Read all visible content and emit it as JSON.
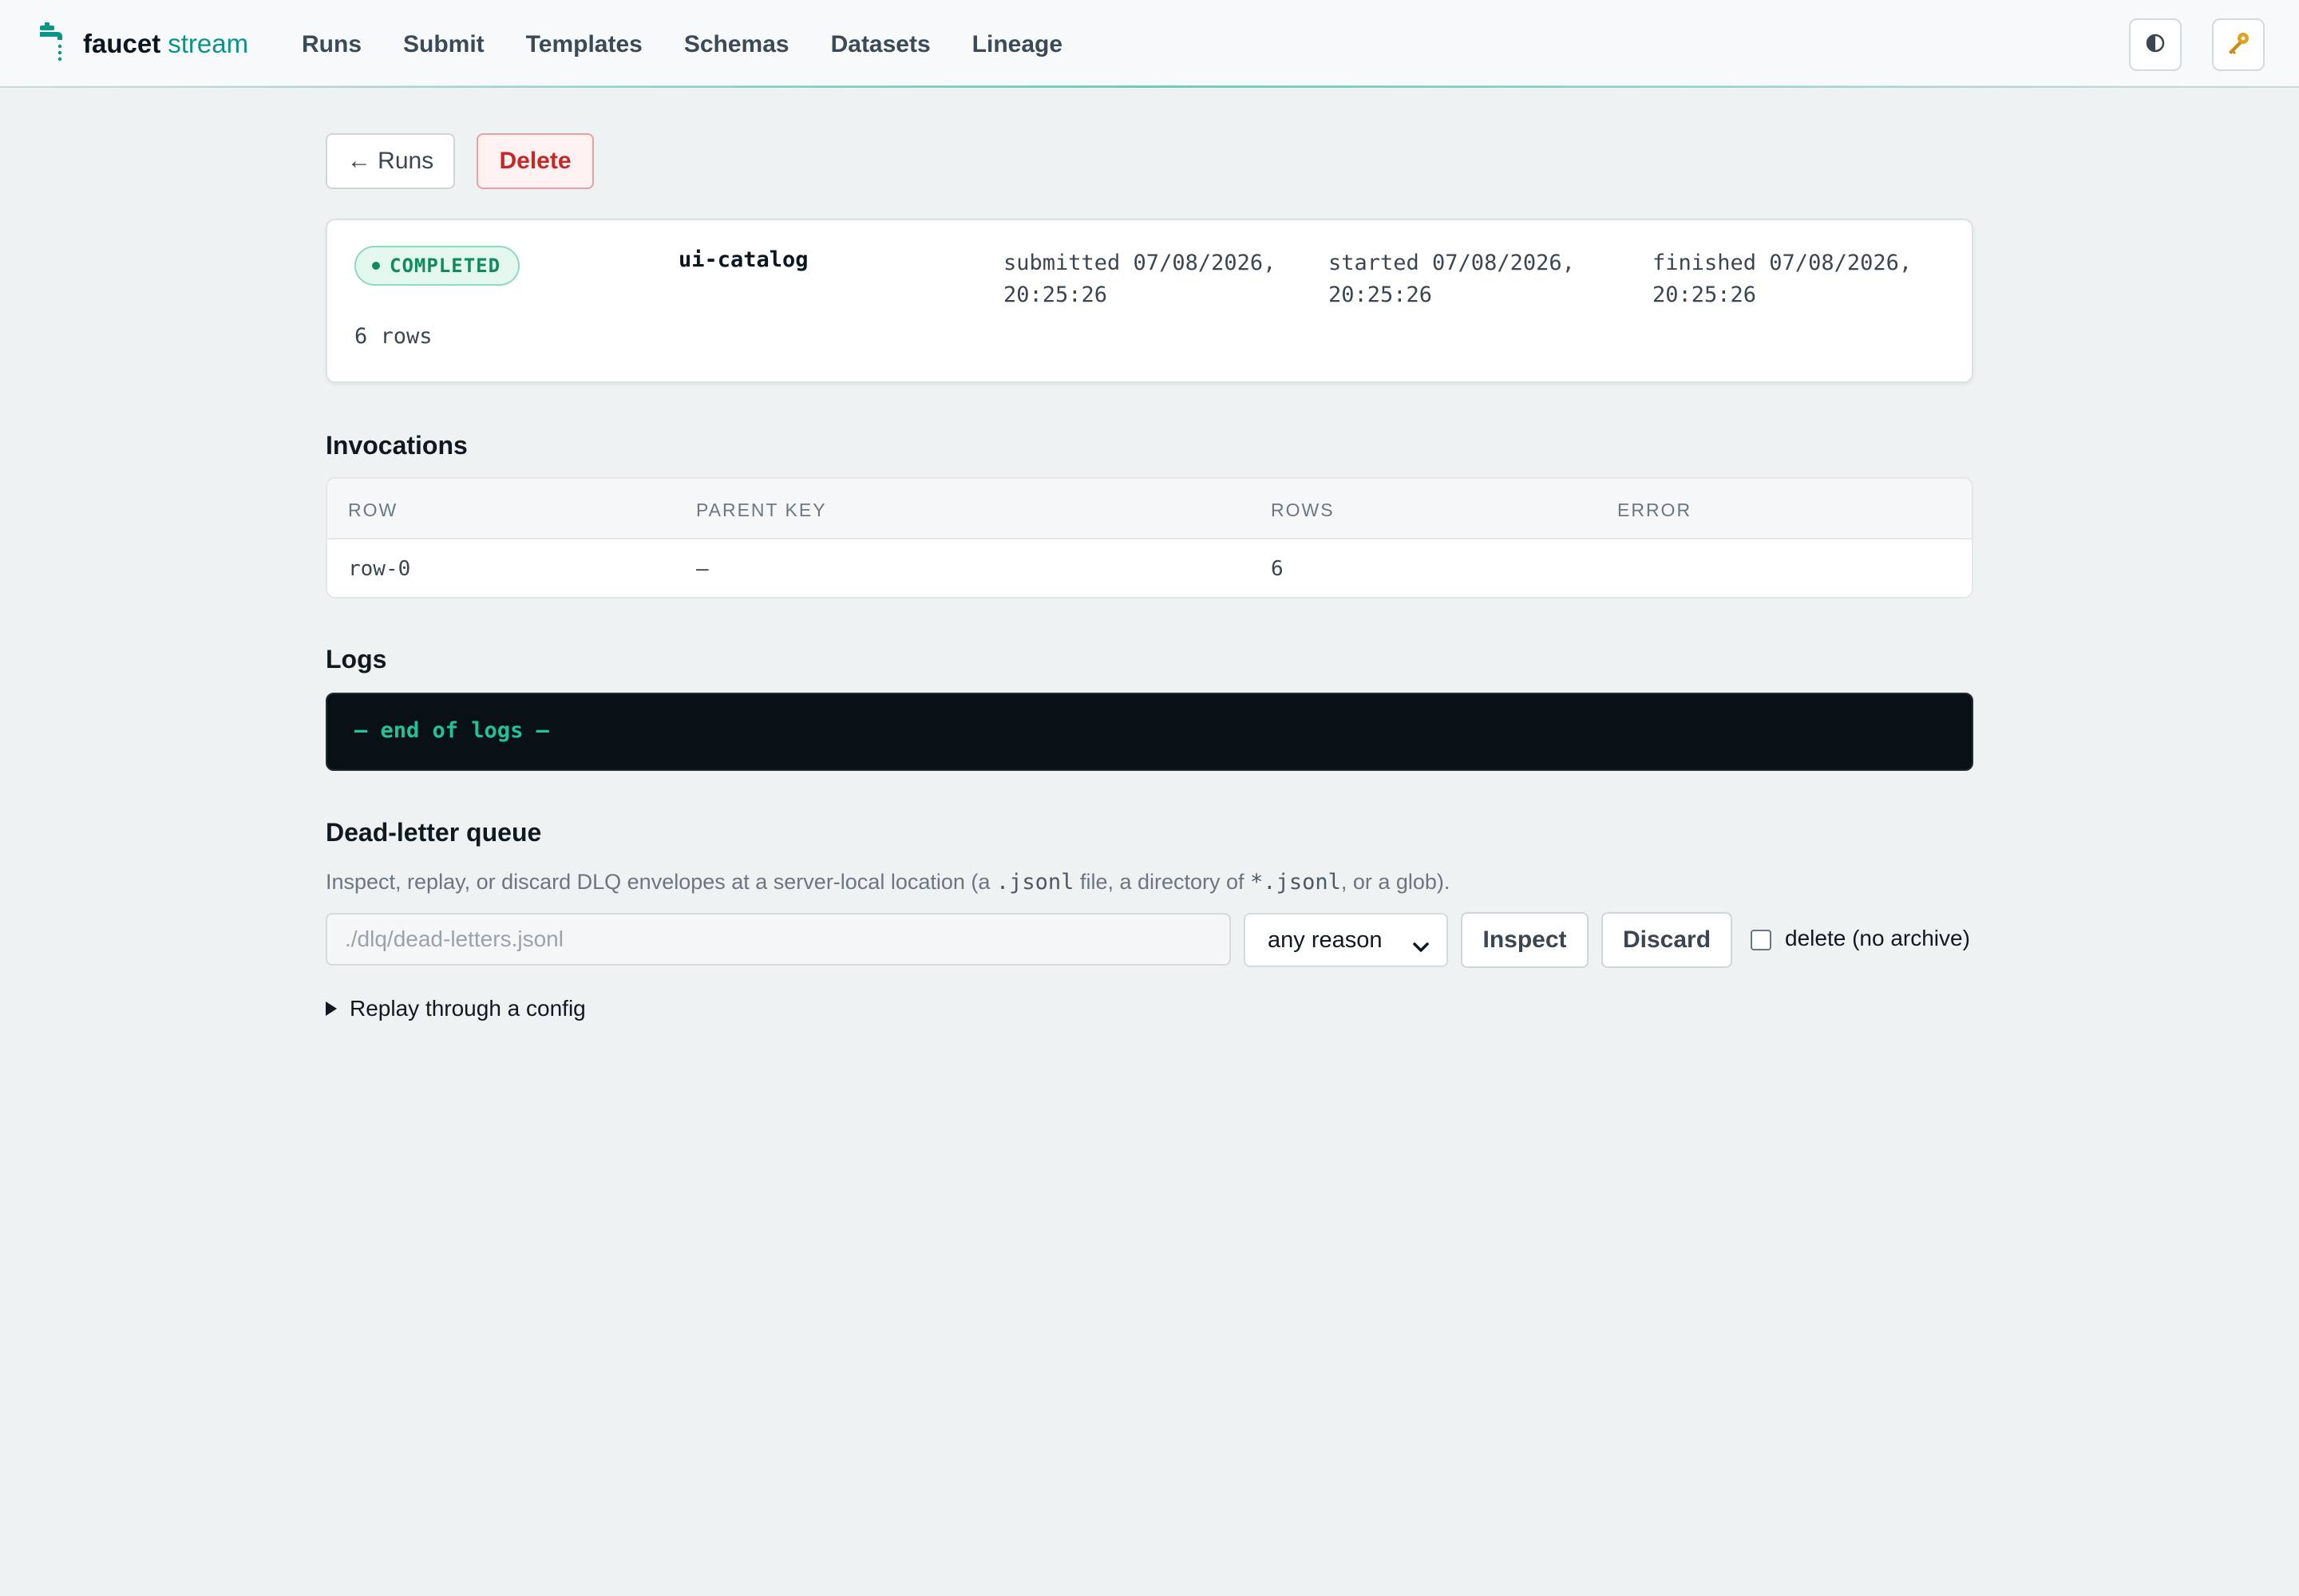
{
  "app": {
    "brand_primary": "faucet",
    "brand_secondary": "stream",
    "accent": "#0d9488"
  },
  "nav": {
    "items": [
      "Runs",
      "Submit",
      "Templates",
      "Schemas",
      "Datasets",
      "Lineage"
    ]
  },
  "header_icons": [
    "theme-toggle-icon",
    "key-icon"
  ],
  "actions": {
    "back_label": "← Runs",
    "delete_label": "Delete"
  },
  "run": {
    "status": "COMPLETED",
    "status_color": "#118a5e",
    "name": "ui-catalog",
    "submitted": [
      "submitted 07/08/2026,",
      "20:25:26"
    ],
    "started": [
      "started 07/08/2026,",
      "20:25:26"
    ],
    "finished": [
      "finished 07/08/2026,",
      "20:25:26"
    ],
    "rows_summary": "6 rows"
  },
  "invocations": {
    "title": "Invocations",
    "columns": [
      "ROW",
      "PARENT KEY",
      "ROWS",
      "ERROR"
    ],
    "rows": [
      {
        "row": "row-0",
        "parent_key": "—",
        "rows": "6",
        "error": ""
      }
    ]
  },
  "logs": {
    "title": "Logs",
    "lines": [
      "— end of logs —"
    ]
  },
  "dlq": {
    "title": "Dead-letter queue",
    "desc_parts": [
      "Inspect, replay, or discard DLQ envelopes at a server-local location (a ",
      ".jsonl",
      " file, a directory of ",
      "*.jsonl",
      ", or a glob)."
    ],
    "path_value": "",
    "path_placeholder": "./dlq/dead-letters.jsonl",
    "reason_selected": "any reason",
    "inspect_label": "Inspect",
    "discard_label": "Discard",
    "delete_checked": false,
    "delete_label": "delete (no archive)",
    "replay_label": "Replay through a config"
  }
}
